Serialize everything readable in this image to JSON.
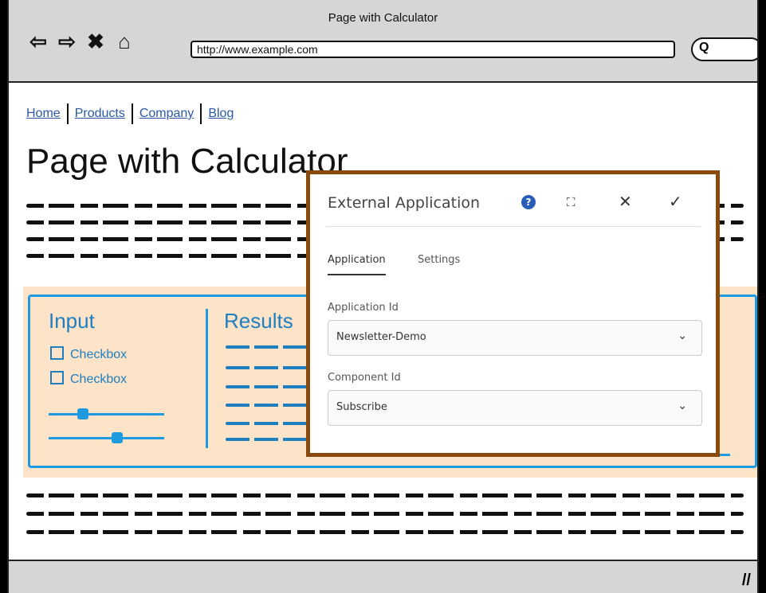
{
  "browser": {
    "window_title": "Page with Calculator",
    "url": "http://www.example.com",
    "back_glyph": "⇦",
    "forward_glyph": "⇨",
    "stop_glyph": "✖",
    "home_glyph": "⌂",
    "search_glyph": "Q"
  },
  "site_nav": {
    "links": [
      "Home",
      "Products",
      "Company",
      "Blog"
    ]
  },
  "page": {
    "title": "Page with Calculator"
  },
  "calculator": {
    "input_heading": "Input",
    "results_heading": "Results",
    "checkboxes": [
      "Checkbox",
      "Checkbox"
    ]
  },
  "dialog": {
    "title": "External Application",
    "help_glyph": "?",
    "fullscreen_glyph": "⛶",
    "close_glyph": "✕",
    "confirm_glyph": "✓",
    "tabs": [
      "Application",
      "Settings"
    ],
    "fields": [
      {
        "label": "Application Id",
        "value": "Newsletter-Demo"
      },
      {
        "label": "Component Id",
        "value": "Subscribe"
      }
    ],
    "chevron_glyph": "⌄"
  },
  "colors": {
    "dialog_border": "#8a4a0b",
    "accent_blue": "#1e9be0",
    "panel_bg": "#fde3c8"
  }
}
